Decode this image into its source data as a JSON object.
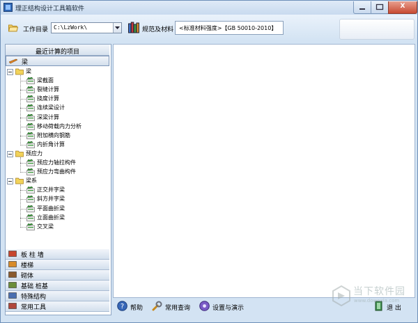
{
  "window": {
    "title": "理正结构设计工具箱软件",
    "close_glyph": "X"
  },
  "toolbar": {
    "workdir_label": "工作目录",
    "workdir_value": "C:\\LzWork\\",
    "standards_label": "规范及材料",
    "standard_value": "<标准材料强度>【GB 50010-2010】"
  },
  "left_panel": {
    "recent_header": "最近计算的项目",
    "active_category": "梁",
    "tree": {
      "groups": [
        {
          "label": "梁",
          "items": [
            "梁截面",
            "裂缝计算",
            "挠度计算",
            "连续梁设计",
            "深梁计算",
            "移动荷载内力分析",
            "附加横向钢筋",
            "内折角计算"
          ]
        },
        {
          "label": "预应力",
          "items": [
            "预应力轴拉构件",
            "预应力弯曲构件"
          ]
        },
        {
          "label": "梁系",
          "items": [
            "正交井字梁",
            "斜方井字梁",
            "平面曲折梁",
            "立面曲折梁",
            "交叉梁"
          ]
        }
      ]
    },
    "categories": [
      "板 柱 墙",
      "楼梯",
      "砌体",
      "基础 桩基",
      "特殊结构",
      "常用工具"
    ]
  },
  "statusbar": {
    "help": "帮助",
    "common_query": "常用查询",
    "settings_demo": "设置与演示",
    "exit": "退 出"
  },
  "watermark": {
    "line1": "当下软件园",
    "line2": "www.downxia.com"
  },
  "colors": {
    "frame": "#d3e3f3",
    "panel_border": "#8ea6c4",
    "leaf_icon_green": "#3a9a3a",
    "folder_yellow": "#f2d35a"
  }
}
